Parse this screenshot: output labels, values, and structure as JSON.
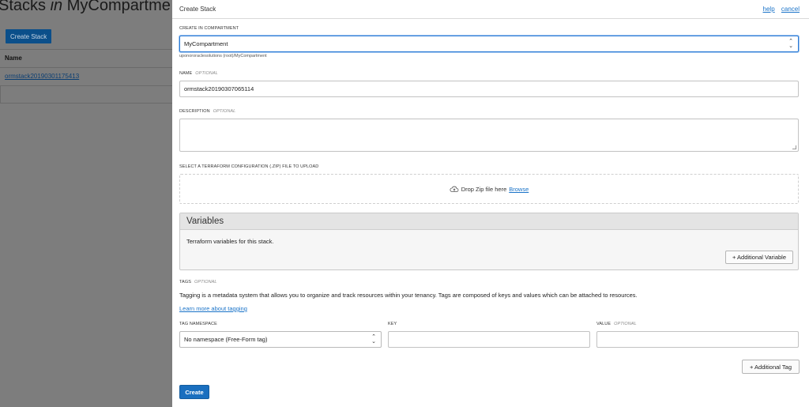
{
  "background": {
    "title_prefix": "Stacks",
    "title_in": "in",
    "title_compartment": "MyCompartme",
    "create_button": "Create Stack",
    "table_header": "Name",
    "rows": [
      "ormstack20190301175413"
    ]
  },
  "panel": {
    "title": "Create Stack",
    "help_link": "help",
    "cancel_link": "cancel",
    "compartment": {
      "label": "CREATE IN COMPARTMENT",
      "value": "MyCompartment",
      "hint": "uponororaclesolutions (root)/MyCompartment"
    },
    "name": {
      "label": "NAME",
      "optional": "OPTIONAL",
      "value": "ormstack20190307065114"
    },
    "description": {
      "label": "DESCRIPTION",
      "optional": "OPTIONAL",
      "value": ""
    },
    "upload": {
      "label": "SELECT A TERRAFORM CONFIGURATION (.ZIP) FILE TO UPLOAD",
      "drop_text": "Drop Zip file here",
      "browse_link": "Browse",
      "icon": "cloud-upload-icon"
    },
    "variables": {
      "title": "Variables",
      "description": "Terraform variables for this stack.",
      "add_button": "+ Additional Variable"
    },
    "tags": {
      "label": "TAGS",
      "optional": "OPTIONAL",
      "description": "Tagging is a metadata system that allows you to organize and track resources within your tenancy. Tags are composed of keys and values which can be attached to resources.",
      "learn_more": "Learn more about tagging",
      "namespace_label": "TAG NAMESPACE",
      "namespace_value": "No namespace (Free-Form tag)",
      "key_label": "KEY",
      "key_value": "",
      "value_label": "VALUE",
      "value_optional": "OPTIONAL",
      "value_value": "",
      "add_button": "+ Additional Tag"
    },
    "create_button": "Create"
  },
  "colors": {
    "accent": "#1a6fbf",
    "link": "#1a73c8",
    "overlay": "#7d7d7d"
  }
}
